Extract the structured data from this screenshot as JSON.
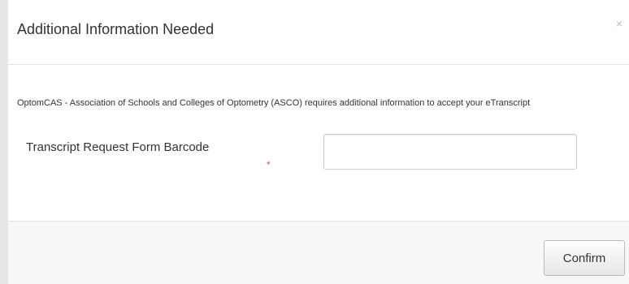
{
  "modal": {
    "title": "Additional Information Needed",
    "close_label": "×"
  },
  "body": {
    "intro_text": "OptomCAS - Association of Schools and Colleges of Optometry (ASCO) requires additional information to accept your eTranscript",
    "field_label": "Transcript Request Form Barcode",
    "required_mark": "*",
    "field_value": "",
    "field_placeholder": ""
  },
  "footer": {
    "confirm_label": "Confirm"
  },
  "colors": {
    "required": "#d9534f",
    "text": "#333333",
    "border": "#e5e5e5"
  }
}
